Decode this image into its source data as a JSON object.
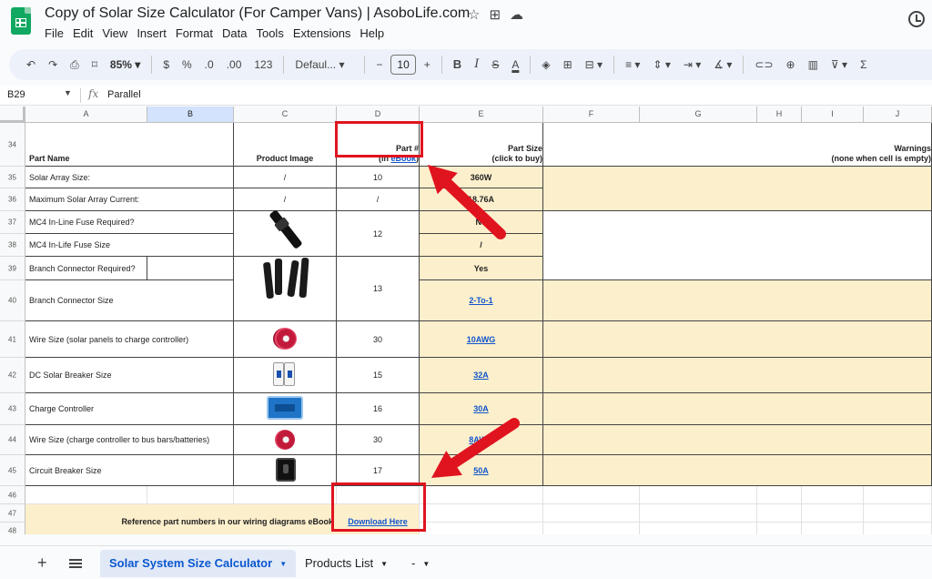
{
  "app": {
    "title": "Copy of Solar Size Calculator (For Camper Vans) | AsoboLife.com",
    "menu": [
      "File",
      "Edit",
      "View",
      "Insert",
      "Format",
      "Data",
      "Tools",
      "Extensions",
      "Help"
    ]
  },
  "toolbar": {
    "zoom": "85%",
    "font": "Defaul...",
    "font_size": "10",
    "currency": "$",
    "percent": "%",
    "dec_less": ".0",
    "dec_more": ".00",
    "number_format": "123",
    "bold": "B",
    "italic": "I",
    "strike": "S",
    "text_color": "A",
    "minus": "−",
    "plus": "+"
  },
  "formula_bar": {
    "cell_ref": "B29",
    "fx": "fx",
    "value": "Parallel"
  },
  "columns": [
    "A",
    "B",
    "C",
    "D",
    "E",
    "F",
    "G",
    "H",
    "I",
    "J"
  ],
  "header_row": {
    "row": "34",
    "part_name": "Part Name",
    "product_image": "Product Image",
    "part_no_line1": "Part #",
    "part_no_prefix": "(in ",
    "part_no_link": "eBook",
    "part_no_suffix": ")",
    "part_size_line1": "Part Size",
    "part_size_line2": "(click to buy)",
    "warnings_line1": "Warnings",
    "warnings_line2": "(none when cell is empty)"
  },
  "rows": [
    {
      "row": "35",
      "name": "Solar Array Size:",
      "image": "/",
      "part": "10",
      "size": "360W"
    },
    {
      "row": "36",
      "name": "Maximum Solar Array Current:",
      "image": "/",
      "part": "/",
      "size": "18.76A"
    },
    {
      "row": "37",
      "name": "MC4 In-Line Fuse Required?",
      "part": "12",
      "size": "No"
    },
    {
      "row": "38",
      "name": "MC4 In-Life Fuse Size",
      "size": "/"
    },
    {
      "row": "39",
      "name": "Branch Connector Required?",
      "part": "13",
      "size": "Yes"
    },
    {
      "row": "40",
      "name": "Branch Connector Size",
      "size": "2-To-1"
    },
    {
      "row": "41",
      "name": "Wire Size (solar panels to charge controller)",
      "part": "30",
      "size": "10AWG"
    },
    {
      "row": "42",
      "name": "DC Solar Breaker Size",
      "part": "15",
      "size": "32A"
    },
    {
      "row": "43",
      "name": "Charge Controller",
      "part": "16",
      "size": "30A"
    },
    {
      "row": "44",
      "name": "Wire Size (charge controller to bus bars/batteries)",
      "part": "30",
      "size": "8AWG"
    },
    {
      "row": "45",
      "name": "Circuit Breaker Size",
      "part": "17",
      "size": "50A"
    }
  ],
  "empty_rows": [
    "46",
    "47",
    "48"
  ],
  "footer": {
    "reference_text": "Reference part numbers in our wiring diagrams eBook",
    "download_link": "Download Here"
  },
  "tabs": [
    {
      "label": "Solar System Size Calculator",
      "active": true
    },
    {
      "label": "Products List",
      "active": false
    },
    {
      "label": "-",
      "active": false
    }
  ],
  "colors": {
    "accent": "#0b57d0",
    "highlight_red": "#e0141f",
    "tan_fill": "#fcefcc",
    "sheets_green": "#11a861"
  }
}
